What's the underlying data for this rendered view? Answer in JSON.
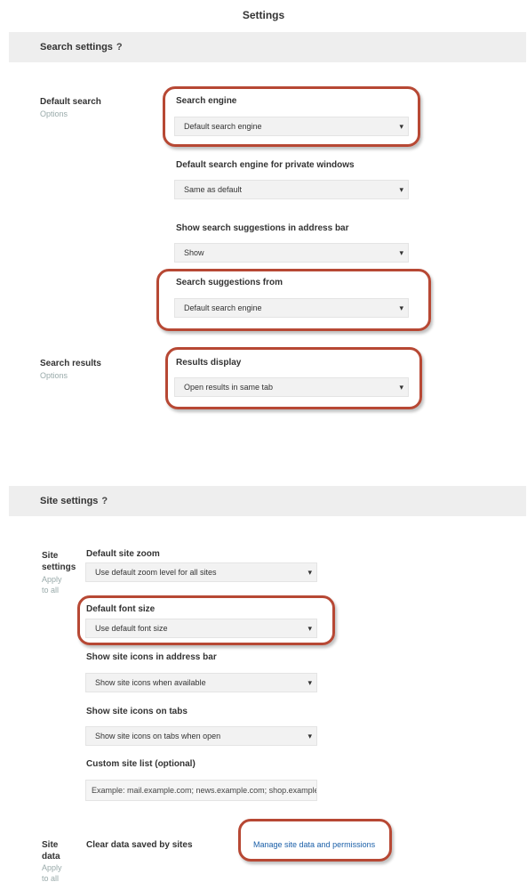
{
  "page": {
    "title": "Settings"
  },
  "section1": {
    "header": "Search settings",
    "help": "?",
    "group1": {
      "label": "Default search",
      "sublabel": "Options",
      "fields": [
        {
          "label": "Search engine",
          "value": "Default search engine"
        },
        {
          "label": "Default search engine for private windows",
          "value": "Same as default"
        },
        {
          "label": "Show search suggestions in address bar",
          "value": "Show"
        },
        {
          "label": "Search suggestions from",
          "value": "Default search engine"
        }
      ]
    },
    "group2": {
      "label": "Search results",
      "sublabel": "Options",
      "fields": [
        {
          "label": "Results display",
          "value": "Open results in same tab"
        }
      ]
    }
  },
  "section2": {
    "header": "Site settings",
    "help": "?",
    "group1": {
      "label": "Site",
      "label2": "settings",
      "sublabel": "Apply",
      "sublabel2": "to all",
      "fields": [
        {
          "label": "Default site zoom",
          "value": "Use default zoom level for all sites"
        },
        {
          "label": "Default font size",
          "value": "Use default font size"
        },
        {
          "label": "Show site icons in address bar",
          "value": "Show site icons when available"
        },
        {
          "label": "Show site icons on tabs",
          "value": "Show site icons on tabs when open"
        },
        {
          "label": "Custom site list (optional)",
          "value": "Example: mail.example.com; news.example.com; shop.example.com"
        }
      ]
    },
    "group2": {
      "label": "Site",
      "label2": "data",
      "sublabel": "Apply",
      "sublabel2": "to all",
      "text": "Clear data saved by sites",
      "link": "Manage site data and permissions"
    }
  },
  "colors": {
    "highlight": "#b74834",
    "band": "#eeeeee",
    "link": "#1a5fa8"
  }
}
